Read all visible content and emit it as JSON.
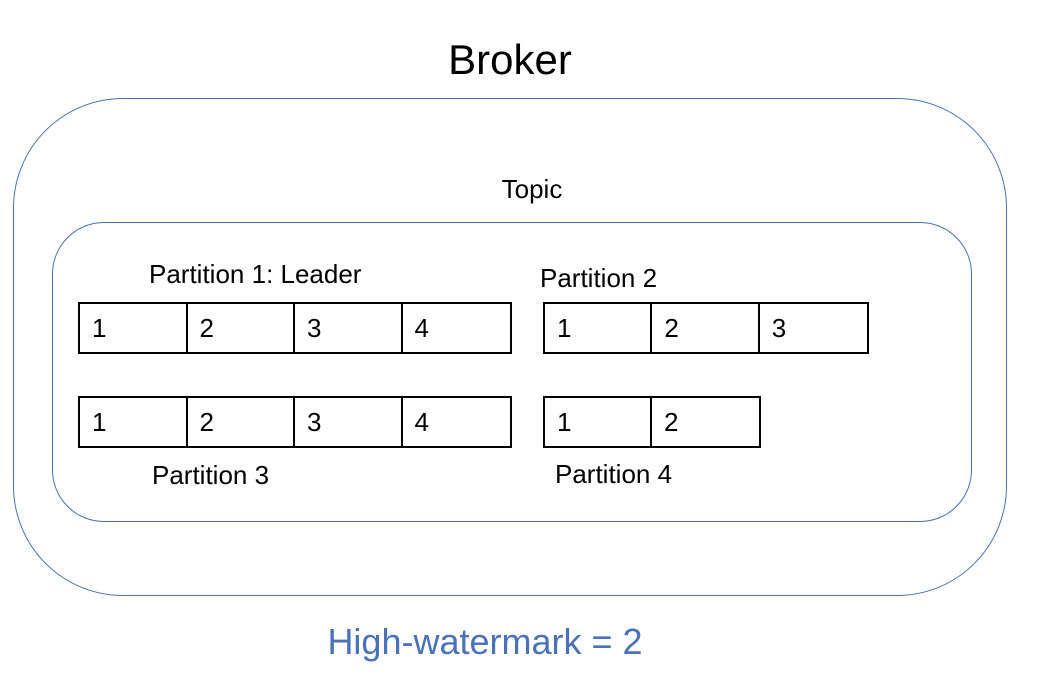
{
  "title": "Broker",
  "topic_label": "Topic",
  "partitions": [
    {
      "label": "Partition 1: Leader",
      "cells": [
        "1",
        "2",
        "3",
        "4"
      ]
    },
    {
      "label": "Partition 2",
      "cells": [
        "1",
        "2",
        "3"
      ]
    },
    {
      "label": "Partition 3",
      "cells": [
        "1",
        "2",
        "3",
        "4"
      ]
    },
    {
      "label": "Partition 4",
      "cells": [
        "1",
        "2"
      ]
    }
  ],
  "high_watermark": "High-watermark = 2",
  "colors": {
    "box_border": "#4a72b0",
    "watermark_text": "#4a72b8"
  }
}
